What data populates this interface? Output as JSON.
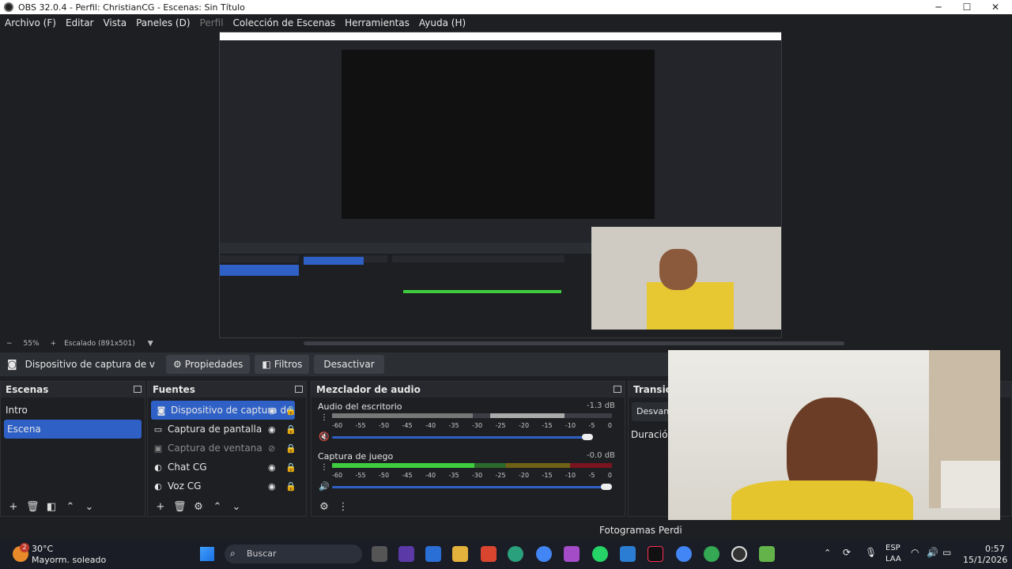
{
  "window": {
    "title": "OBS 32.0.4 - Perfil: ChristianCG - Escenas: Sin Título"
  },
  "menu": [
    "Archivo (F)",
    "Editar",
    "Vista",
    "Paneles (D)",
    "Perfil",
    "Colección de Escenas",
    "Herramientas",
    "Ayuda (H)"
  ],
  "status": {
    "zoom": "55%",
    "scaling": "Escalado (891x501)"
  },
  "toolbar": {
    "source_name": "Dispositivo de captura de v",
    "properties": "Propiedades",
    "filters": "Filtros",
    "deactivate": "Desactivar"
  },
  "scenes": {
    "title": "Escenas",
    "items": [
      "Intro",
      "Escena"
    ],
    "selected": 1
  },
  "sources": {
    "title": "Fuentes",
    "items": [
      {
        "label": "Dispositivo de captura de",
        "icon": "camera-icon",
        "visible": true,
        "selected": true
      },
      {
        "label": "Captura de pantalla",
        "icon": "monitor-icon",
        "visible": true,
        "selected": false
      },
      {
        "label": "Captura de ventana",
        "icon": "window-icon",
        "visible": false,
        "selected": false
      },
      {
        "label": "Chat CG",
        "icon": "browser-icon",
        "visible": true,
        "selected": false
      },
      {
        "label": "Voz CG",
        "icon": "browser-icon",
        "visible": true,
        "selected": false
      }
    ]
  },
  "mixer": {
    "title": "Mezclador de audio",
    "channels": [
      {
        "name": "Audio del escritorio",
        "db": "-1.3 dB",
        "muted": true,
        "level": 0.85
      },
      {
        "name": "Captura de juego",
        "db": "-0.0 dB",
        "muted": false,
        "level": 1.0
      }
    ],
    "scale": [
      "-60",
      "-55",
      "-50",
      "-45",
      "-40",
      "-35",
      "-30",
      "-25",
      "-20",
      "-15",
      "-10",
      "-5",
      "0"
    ]
  },
  "transitions": {
    "title": "Transicio",
    "type": "Desvane",
    "duration_label": "Duración"
  },
  "bottom_status": {
    "frames": "Fotogramas Perdi"
  },
  "taskbar": {
    "weather_temp": "30°C",
    "weather_desc": "Mayorm. soleado",
    "weather_badge": "2",
    "search": "Buscar",
    "lang1": "ESP",
    "lang2": "LAA",
    "time": "0:57",
    "date": "15/1/2026"
  },
  "colors": {
    "accent": "#2e60c6",
    "meter_green": "#3fcc3f",
    "meter_yellow": "#9a8a18",
    "meter_red": "#b51c2e"
  }
}
